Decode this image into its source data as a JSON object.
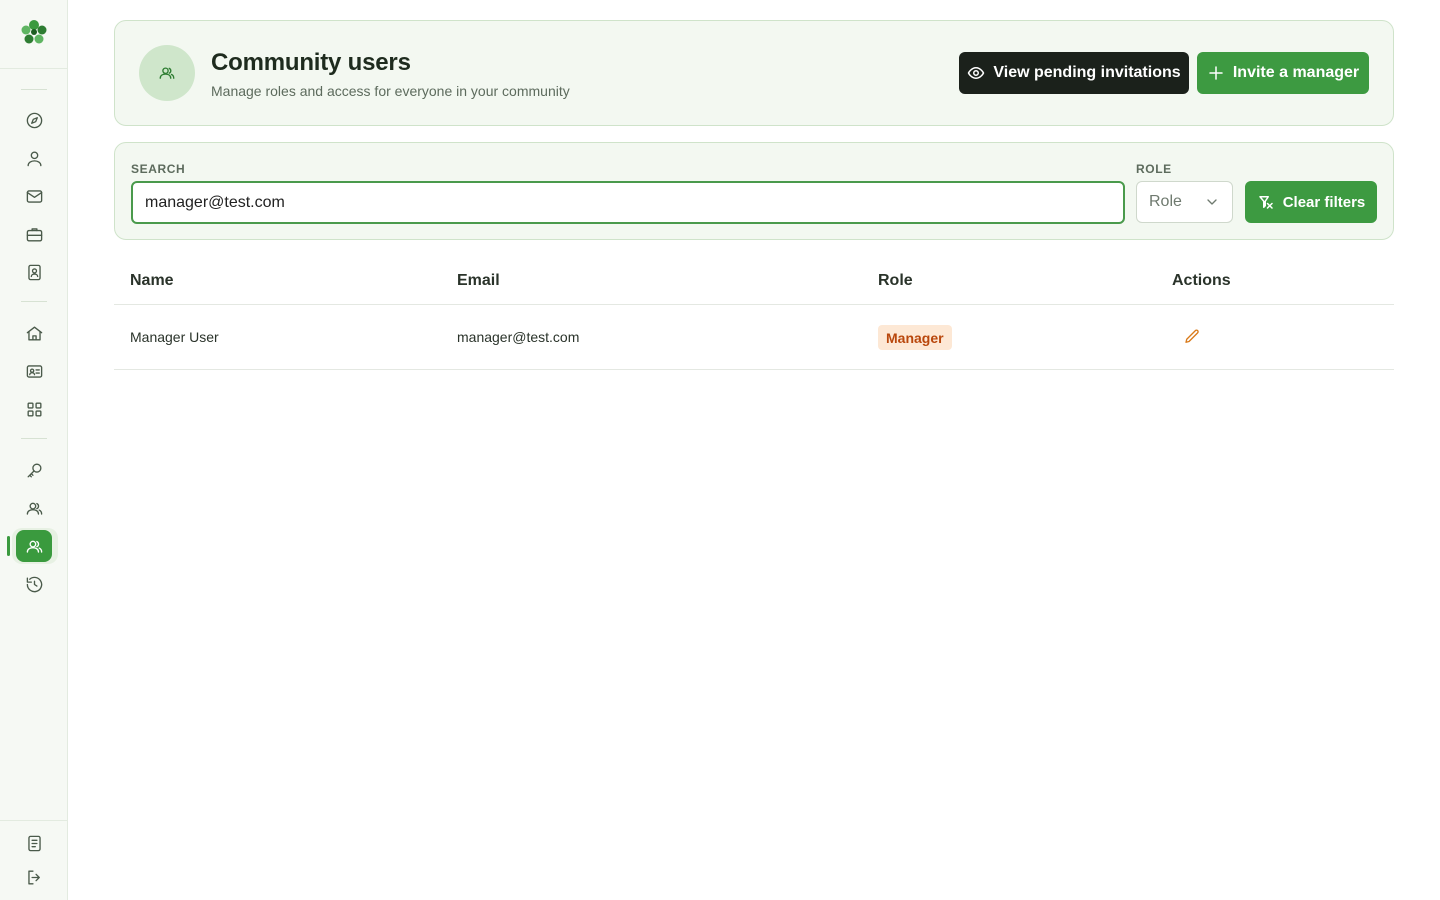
{
  "header": {
    "title": "Community users",
    "subtitle": "Manage roles and access for everyone in your community",
    "icon": "users-icon",
    "buttons": {
      "view_pending": "View pending invitations",
      "invite": "Invite a manager"
    }
  },
  "filters": {
    "search_label": "SEARCH",
    "search_value": "manager@test.com",
    "role_label": "ROLE",
    "role_value": "Role",
    "clear_label": "Clear filters"
  },
  "table": {
    "columns": [
      "Name",
      "Email",
      "Role",
      "Actions"
    ],
    "rows": [
      {
        "name": "Manager User",
        "email": "manager@test.com",
        "role": "Manager",
        "action_icon": "edit-pencil-icon"
      }
    ]
  },
  "sidebar": {
    "items": [
      "compass-icon",
      "user-icon",
      "mail-icon",
      "briefcase-icon",
      "contacts-icon",
      "home-icon",
      "id-card-icon",
      "grid-icon",
      "key-icon",
      "group-icon",
      "community-users-icon",
      "history-icon",
      "document-icon",
      "logout-icon"
    ],
    "active": "community-users-icon"
  },
  "colors": {
    "accent": "#3d9a41",
    "dark_button": "#1b211b",
    "badge_bg": "#fde8d5",
    "badge_text": "#b9470c"
  }
}
